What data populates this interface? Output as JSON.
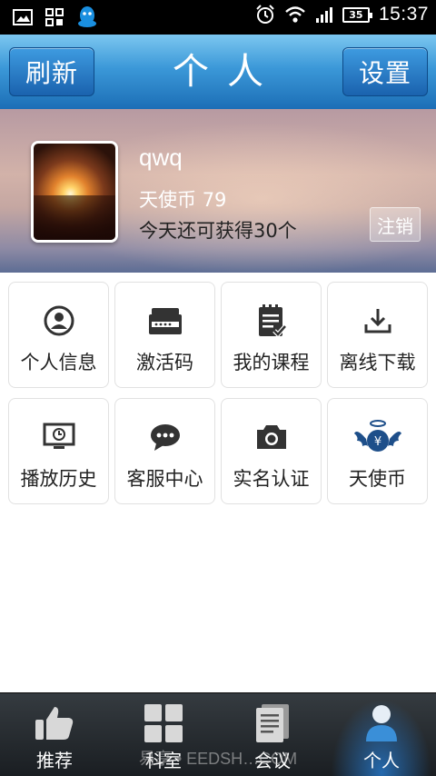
{
  "status_bar": {
    "time": "15:37",
    "battery": "35",
    "left_icons": [
      "image-icon",
      "grid-icon",
      "qq-icon"
    ],
    "right_icons": [
      "alarm-icon",
      "wifi-icon",
      "signal-icon",
      "battery-icon"
    ]
  },
  "header": {
    "refresh_label": "刷新",
    "title": "个人",
    "settings_label": "设置"
  },
  "profile": {
    "username": "qwq",
    "coins_label": "天使币",
    "coins_value": "79",
    "today_text": "今天还可获得30个",
    "logout_label": "注销"
  },
  "grid": {
    "items": [
      {
        "label": "个人信息",
        "icon": "user-icon"
      },
      {
        "label": "激活码",
        "icon": "card-icon"
      },
      {
        "label": "我的课程",
        "icon": "notebook-icon"
      },
      {
        "label": "离线下载",
        "icon": "download-icon"
      },
      {
        "label": "播放历史",
        "icon": "monitor-history-icon"
      },
      {
        "label": "客服中心",
        "icon": "chat-icon"
      },
      {
        "label": "实名认证",
        "icon": "camera-icon"
      },
      {
        "label": "天使币",
        "icon": "angel-coin-icon"
      }
    ]
  },
  "bottom_nav": {
    "items": [
      {
        "label": "推荐",
        "icon": "thumbs-up-icon",
        "active": false
      },
      {
        "label": "科室",
        "icon": "grid-icon",
        "active": false
      },
      {
        "label": "会议",
        "icon": "document-icon",
        "active": false
      },
      {
        "label": "个人",
        "icon": "person-icon",
        "active": true
      }
    ],
    "watermark": "易享 • EEDSH…COM"
  },
  "colors": {
    "header_blue": "#1c6eb6",
    "icon_dark": "#333333",
    "active_glow": "#2882dc"
  }
}
